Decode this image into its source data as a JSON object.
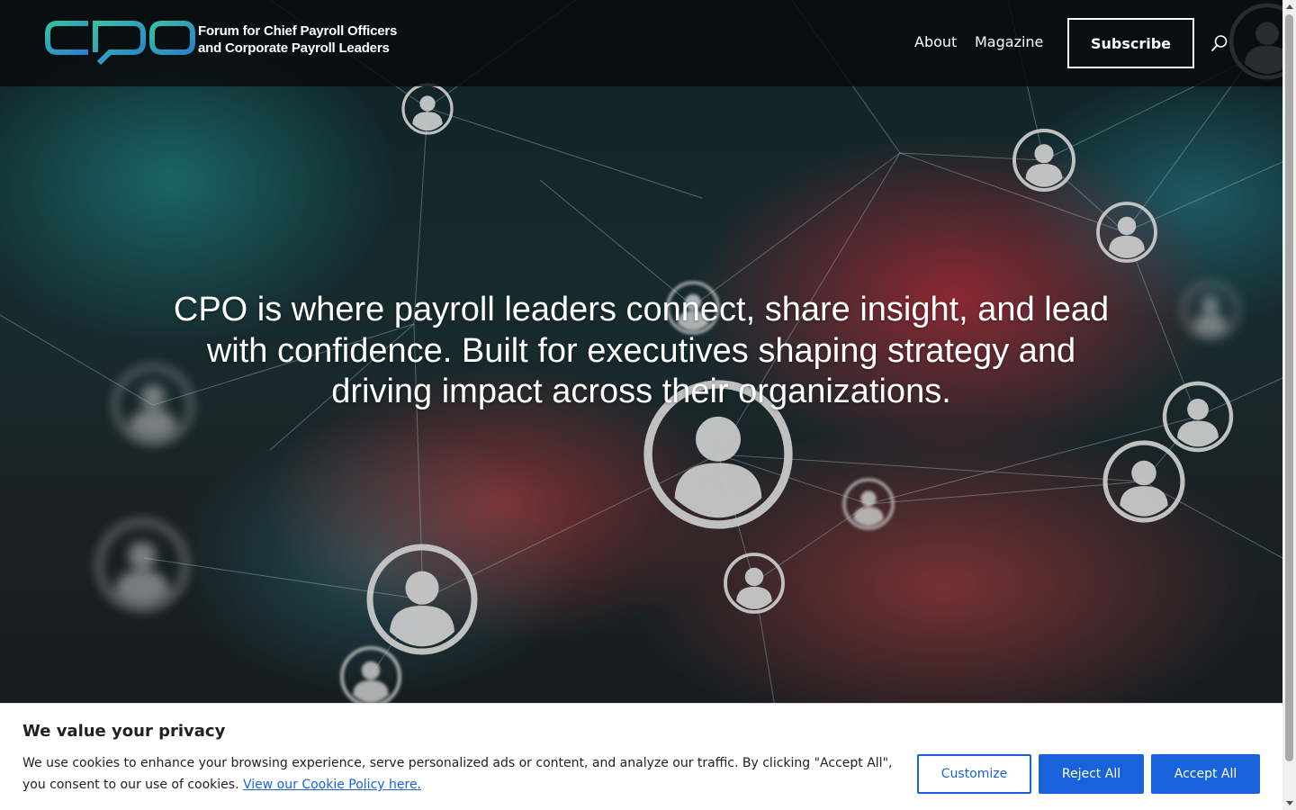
{
  "header": {
    "logo_text": "CPO",
    "tagline_line1": "Forum for Chief Payroll Officers",
    "tagline_line2": "and Corporate Payroll Leaders",
    "nav": {
      "about": "About",
      "magazine": "Magazine"
    },
    "subscribe_label": "Subscribe"
  },
  "hero": {
    "headline": "CPO is where payroll leaders connect, share insight, and lead with confidence. Built for executives shaping strategy and driving impact across their organizations."
  },
  "cookie_banner": {
    "title": "We value your privacy",
    "text": "We use cookies to enhance your browsing experience, serve personalized ads or content, and analyze our traffic. By clicking \"Accept All\", you consent to our use of cookies.",
    "policy_link": "View our Cookie Policy here.",
    "customize_label": "Customize",
    "reject_label": "Reject All",
    "accept_label": "Accept All"
  },
  "colors": {
    "accent_blue": "#1863dc",
    "logo_teal": "#2bb3a3",
    "logo_blue": "#2a8bd0"
  }
}
